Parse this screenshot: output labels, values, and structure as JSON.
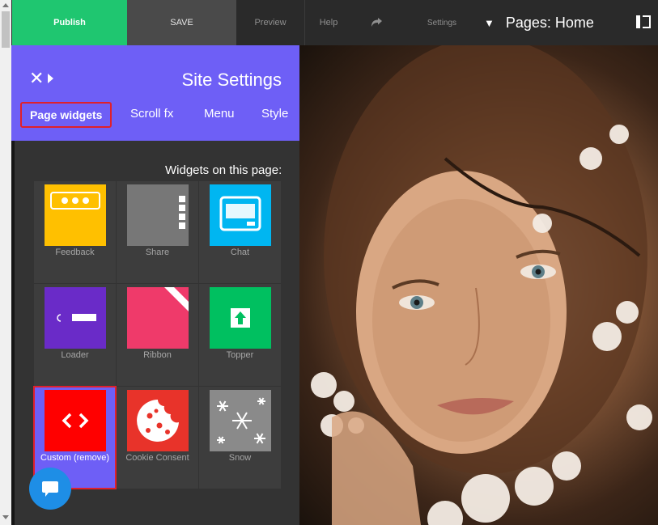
{
  "topbar": {
    "publish_label": "Publish",
    "save_label": "SAVE",
    "preview_label": "Preview",
    "help_label": "Help",
    "settings_label": "Settings",
    "pages_label": "Pages: Home"
  },
  "panel": {
    "title": "Site Settings",
    "tabs": [
      "Style",
      "Menu",
      "Scroll fx",
      "Page widgets"
    ],
    "active_tab": "Page widgets",
    "widgets_heading": "Widgets on this page:",
    "widgets": [
      {
        "label": "Chat",
        "color": "#00b6f1"
      },
      {
        "label": "Share",
        "color": "#777777"
      },
      {
        "label": "Feedback",
        "color": "#ffc000"
      },
      {
        "label": "Topper",
        "color": "#00c060"
      },
      {
        "label": "Ribbon",
        "color": "#ef3a6a"
      },
      {
        "label": "Loader",
        "color": "#6a2bc8"
      },
      {
        "label": "Snow",
        "color": "#8a8a8a"
      },
      {
        "label": "Cookie Consent",
        "color": "#e8332a"
      },
      {
        "label": "Custom (remove)",
        "color": "#ff0000"
      }
    ]
  },
  "colors": {
    "accent": "#6e5ff6",
    "publish": "#1fc670",
    "highlight": "#e0202b"
  }
}
